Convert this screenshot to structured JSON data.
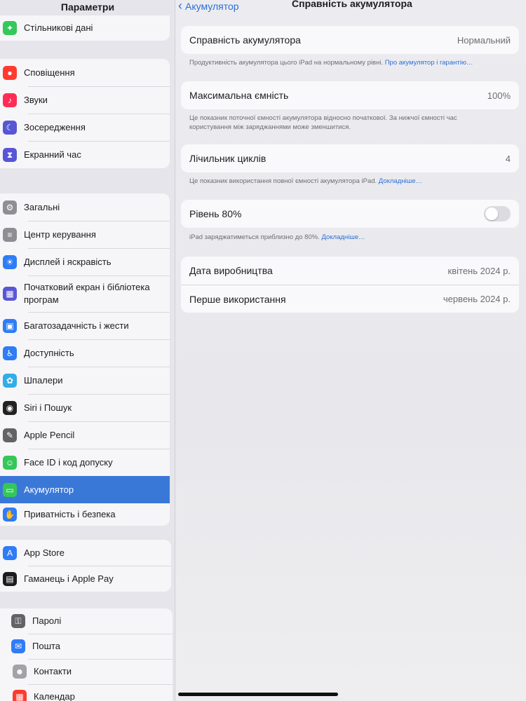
{
  "sidebar": {
    "title": "Параметри",
    "groups": [
      {
        "items": [
          {
            "label": "Стільникові дані",
            "icon": "antenna-icon",
            "color": "#34c759"
          }
        ]
      },
      {
        "items": [
          {
            "label": "Сповіщення",
            "icon": "bell-icon",
            "color": "#ff3b30"
          },
          {
            "label": "Звуки",
            "icon": "speaker-icon",
            "color": "#ff2d55"
          },
          {
            "label": "Зосередження",
            "icon": "moon-icon",
            "color": "#5856d6"
          },
          {
            "label": "Екранний час",
            "icon": "hourglass-icon",
            "color": "#5856d6"
          }
        ]
      },
      {
        "items": [
          {
            "label": "Загальні",
            "icon": "gear-icon",
            "color": "#8e8e93"
          },
          {
            "label": "Центр керування",
            "icon": "switches-icon",
            "color": "#8e8e93"
          },
          {
            "label": "Дисплей і яскравість",
            "icon": "sun-icon",
            "color": "#2f7cf6"
          },
          {
            "label": "Початковий екран і бібліотека програм",
            "icon": "home-grid-icon",
            "color": "#5856d6"
          },
          {
            "label": "Багатозадачність і жести",
            "icon": "multitask-icon",
            "color": "#2f7cf6"
          },
          {
            "label": "Доступність",
            "icon": "accessibility-icon",
            "color": "#2f7cf6"
          },
          {
            "label": "Шпалери",
            "icon": "flower-icon",
            "color": "#32ade6"
          },
          {
            "label": "Siri і Пошук",
            "icon": "siri-icon",
            "color": "#222222"
          },
          {
            "label": "Apple Pencil",
            "icon": "pencil-icon",
            "color": "#636366"
          },
          {
            "label": "Face ID і код допуску",
            "icon": "face-id-icon",
            "color": "#34c759"
          },
          {
            "label": "Акумулятор",
            "icon": "battery-icon",
            "color": "#34c759"
          },
          {
            "label": "Приватність і безпека",
            "icon": "hand-icon",
            "color": "#2f7cf6"
          }
        ]
      },
      {
        "items": [
          {
            "label": "App Store",
            "icon": "app-store-icon",
            "color": "#2f7cf6"
          },
          {
            "label": "Гаманець і Apple Pay",
            "icon": "wallet-icon",
            "color": "#1c1c1e"
          }
        ]
      },
      {
        "items": [
          {
            "label": "Паролі",
            "icon": "key-icon",
            "color": "#636366"
          },
          {
            "label": "Пошта",
            "icon": "mail-icon",
            "color": "#2f7cf6"
          },
          {
            "label": "Контакти",
            "icon": "contacts-icon",
            "color": "#a2a2a7"
          },
          {
            "label": "Календар",
            "icon": "calendar-icon",
            "color": "#ff3b30"
          }
        ]
      }
    ],
    "selected_label": "Акумулятор",
    "selected_color": "#3a78d8"
  },
  "nav": {
    "back_label": "Акумулятор",
    "title": "Справність акумулятора"
  },
  "health": {
    "label": "Справність акумулятора",
    "value": "Нормальний",
    "note": "Продуктивність акумулятора цього iPad на нормальному рівні.",
    "note_link": "Про акумулятор і гарантію…"
  },
  "capacity": {
    "label": "Максимальна ємність",
    "value": "100%",
    "note": "Це показник поточної ємності акумулятора відносно початкової. За нижчої ємності час користування між заряджаннями може зменшитися."
  },
  "cycles": {
    "label": "Лічильник циклів",
    "value": "4",
    "note": "Це показник використання повної ємності акумулятора iPad.",
    "note_link": "Докладніше…"
  },
  "limit": {
    "label": "Рівень 80%",
    "enabled": false,
    "note": "iPad заряджатиметься приблизно до 80%.",
    "note_link": "Докладніше…"
  },
  "dates": {
    "manufactured_label": "Дата виробництва",
    "manufactured_value": "квітень 2024 р.",
    "first_use_label": "Перше використання",
    "first_use_value": "червень 2024 р."
  },
  "colors": {
    "link": "#2b6fd6",
    "toggle_off": "#dcdce0"
  }
}
